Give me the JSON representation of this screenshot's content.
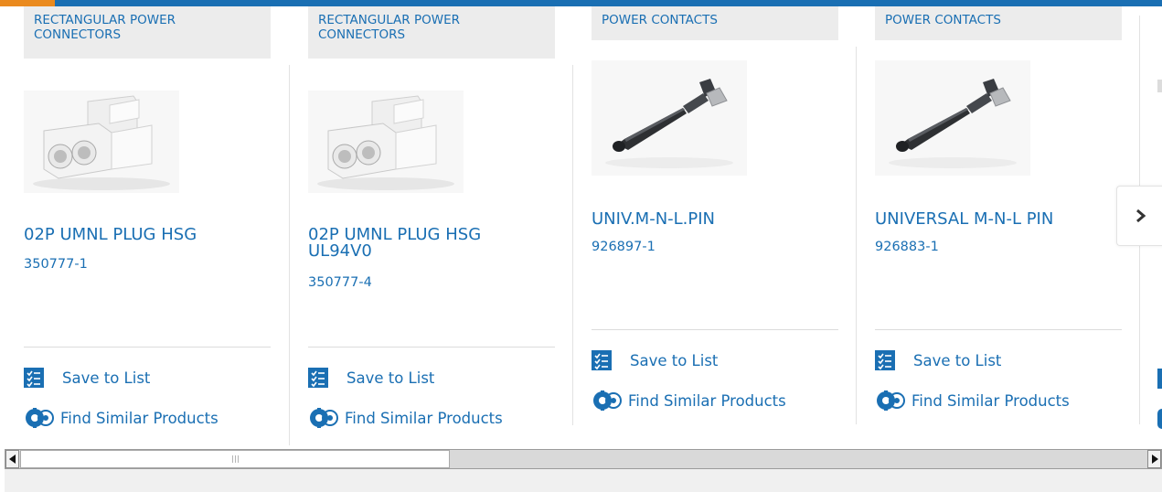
{
  "cards": [
    {
      "category": "RECTANGULAR POWER CONNECTORS",
      "name": "02P UMNL PLUG HSG",
      "part_number": "350777-1",
      "image": "white-plug-housing",
      "save_label": "Save to List",
      "similar_label": "Find Similar Products"
    },
    {
      "category": "RECTANGULAR POWER CONNECTORS",
      "name": "02P UMNL PLUG HSG UL94V0",
      "part_number": "350777-4",
      "image": "white-plug-housing",
      "save_label": "Save to List",
      "similar_label": "Find Similar Products"
    },
    {
      "category": "POWER CONTACTS",
      "name": "UNIV.M-N-L.PIN",
      "part_number": "926897-1",
      "image": "crimp-pin-contact",
      "save_label": "Save to List",
      "similar_label": "Find Similar Products"
    },
    {
      "category": "POWER CONTACTS",
      "name": "UNIVERSAL M-N-L PIN",
      "part_number": "926883-1",
      "image": "crimp-pin-contact",
      "save_label": "Save to List",
      "similar_label": "Find Similar Products"
    }
  ],
  "icons": {
    "next": "chevron-right-icon",
    "save": "checklist-icon",
    "similar": "similar-products-icon",
    "scroll_left": "arrow-left-icon",
    "scroll_right": "arrow-right-icon"
  },
  "colors": {
    "brand_blue": "#1a6fb3",
    "accent_orange": "#ea8a1e",
    "tag_background": "#ececec"
  }
}
